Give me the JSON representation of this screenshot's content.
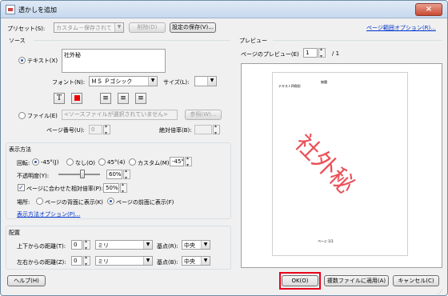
{
  "window": {
    "title": "透かしを追加",
    "close_label": "×"
  },
  "preset": {
    "label": "プリセット(S):",
    "value": "カスタム－保存されて",
    "delete_label": "削除(D)",
    "save_label": "設定の保存(V)...",
    "page_range_link": "ページ範囲オプション(R)..."
  },
  "source": {
    "title": "ソース",
    "text_label": "テキスト(X)",
    "text_value": "社外秘",
    "font_label": "フォント(N):",
    "font_value": "ＭＳ Ｐゴシック",
    "size_label": "サイズ(L):",
    "size_value": "",
    "file_label": "ファイル(E)",
    "file_value": "<ソースファイルが選択されていません>",
    "browse_label": "参照(W)...",
    "page_no_label": "ページ番号(U):",
    "page_no_value": "0",
    "abs_scale_label": "絶対倍率(B):"
  },
  "appearance": {
    "title": "表示方法",
    "rotation_label": "回転:",
    "rot_m45": "-45°(J)",
    "rot_none": "なし(O)",
    "rot_45": "45°(4)",
    "rot_custom": "カスタム(M)",
    "rot_custom_value": "-45°",
    "opacity_label": "不透明度(Y):",
    "opacity_value": "60%",
    "fit_label": "ページに合わせた相対倍率(P):",
    "fit_value": "50%",
    "location_label": "場所:",
    "loc_back": "ページの背面に表示(K)",
    "loc_front": "ページの前面に表示(F)",
    "options_link": "表示方法オプション(P)..."
  },
  "position": {
    "title": "配置",
    "vert_label": "上下からの距離(T):",
    "vert_value": "0",
    "vert_unit": "ミリ",
    "vert_base_label": "基点(R):",
    "vert_base": "中央",
    "horiz_label": "左右からの距離(Z):",
    "horiz_value": "0",
    "horiz_unit": "ミリ",
    "horiz_base_label": "基点(B):",
    "horiz_base": "中央"
  },
  "preview": {
    "title": "プレビュー",
    "page_label": "ページのプレビュー(E)",
    "page_value": "1",
    "page_total": "/ 1",
    "doc_left_text": "テキスト四角形",
    "doc_right_text": "無題",
    "doc_footer": "ページ 1/1",
    "watermark": "社外秘",
    "watermark_color": "#e8323c"
  },
  "buttons": {
    "help": "ヘルプ(H)",
    "ok": "OK(O)",
    "apply_multi": "複数ファイルに適用(A)",
    "cancel": "キャンセル(C)"
  },
  "highlight_color": "#e8001c"
}
